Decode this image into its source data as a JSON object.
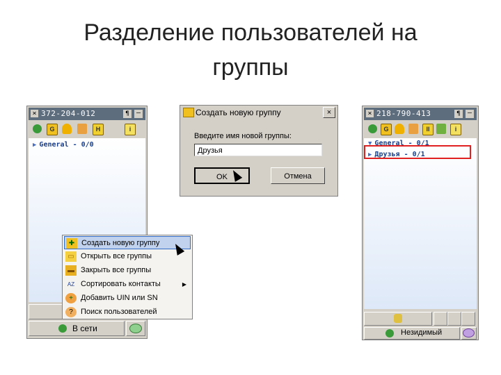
{
  "slide": {
    "title_line1": "Разделение пользователей на",
    "title_line2": "группы"
  },
  "left_window": {
    "uin": "372-204-012",
    "close_glyph": "×",
    "pin_glyph": "¶",
    "min_glyph": "–",
    "toolbar_icons": [
      "clover-icon",
      "g-icon",
      "bell-icon",
      "contacts-icon",
      "h-icon",
      "info-icon"
    ],
    "toolbar_letters": {
      "g": "G",
      "h": "H",
      "i": "i"
    },
    "groups": [
      {
        "arrow": "▶",
        "label": "General - 0/0"
      }
    ],
    "status_label": "В сети",
    "accent": "#5d6d7d"
  },
  "right_window": {
    "uin": "218-790-413",
    "close_glyph": "×",
    "pin_glyph": "¶",
    "min_glyph": "–",
    "toolbar_letters": {
      "g": "G",
      "h": "II",
      "i": "i"
    },
    "groups": [
      {
        "arrow": "▼",
        "label": "General - 0/1"
      },
      {
        "arrow": "▶",
        "label": "Друзья - 0/1"
      }
    ],
    "status_label": "Незидимый",
    "highlight_color": "#e02020"
  },
  "dialog": {
    "title": "Создать новую группу",
    "close_glyph": "×",
    "prompt": "Введите имя новой группы:",
    "input_value": "Друзья",
    "ok_label": "OK",
    "cancel_label": "Отмена"
  },
  "context_menu": {
    "items": [
      {
        "icon": "new-folder-icon",
        "glyph": "✚",
        "label": "Создать новую группу",
        "selected": true
      },
      {
        "icon": "folder-open-icon",
        "glyph": "▭",
        "label": "Открыть все группы"
      },
      {
        "icon": "folder-closed-icon",
        "glyph": "▬",
        "label": "Закрыть все группы"
      },
      {
        "icon": "sort-az-icon",
        "glyph": "AZ",
        "label": "Сортировать контакты",
        "submenu_glyph": "▶"
      },
      {
        "icon": "add-user-icon",
        "glyph": "+",
        "label": "Добавить UIN или SN"
      },
      {
        "icon": "search-user-icon",
        "glyph": "?",
        "label": "Поиск пользователей"
      }
    ]
  }
}
